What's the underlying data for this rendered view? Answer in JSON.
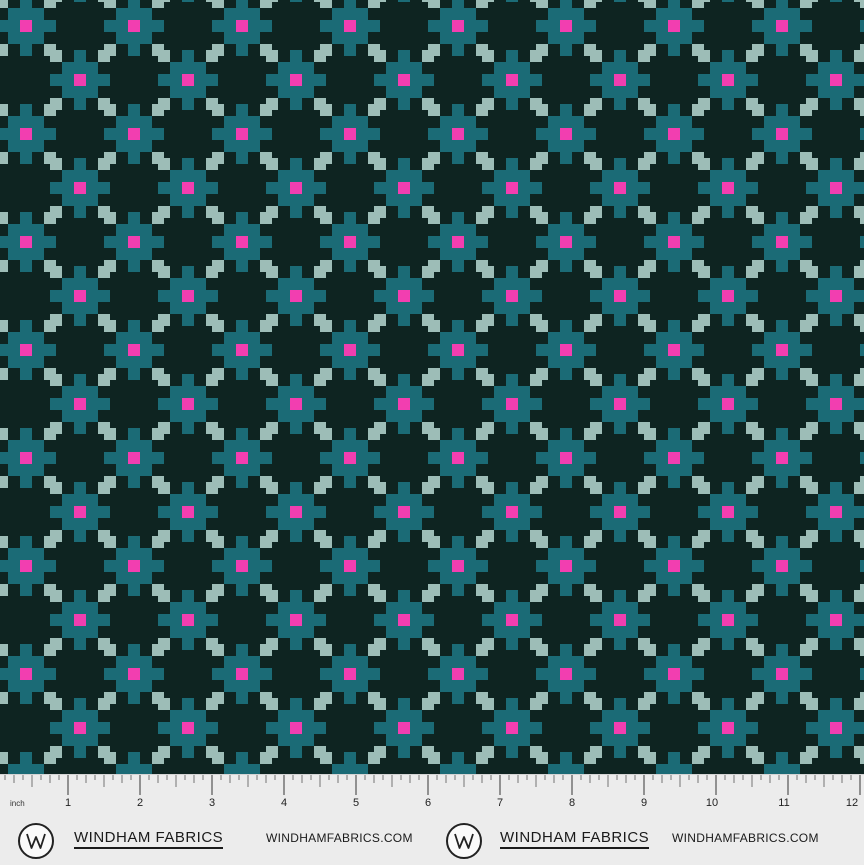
{
  "fabric": {
    "colors": {
      "background": "#0e2421",
      "light_sage": "#9dbdb7",
      "teal": "#1b6b76",
      "pink": "#f23eb0"
    }
  },
  "ruler": {
    "unit_label": "inch",
    "numbers": [
      "1",
      "2",
      "3",
      "4",
      "5",
      "6",
      "7",
      "8",
      "9",
      "10",
      "11",
      "12"
    ]
  },
  "selvage": {
    "brands": [
      {
        "name": "WINDHAM FABRICS",
        "website": "WINDHAMFABRICS.COM",
        "logo_icon": "w-monogram-icon"
      },
      {
        "name": "WINDHAM FABRICS",
        "website": "WINDHAMFABRICS.COM",
        "logo_icon": "w-monogram-icon"
      }
    ]
  }
}
